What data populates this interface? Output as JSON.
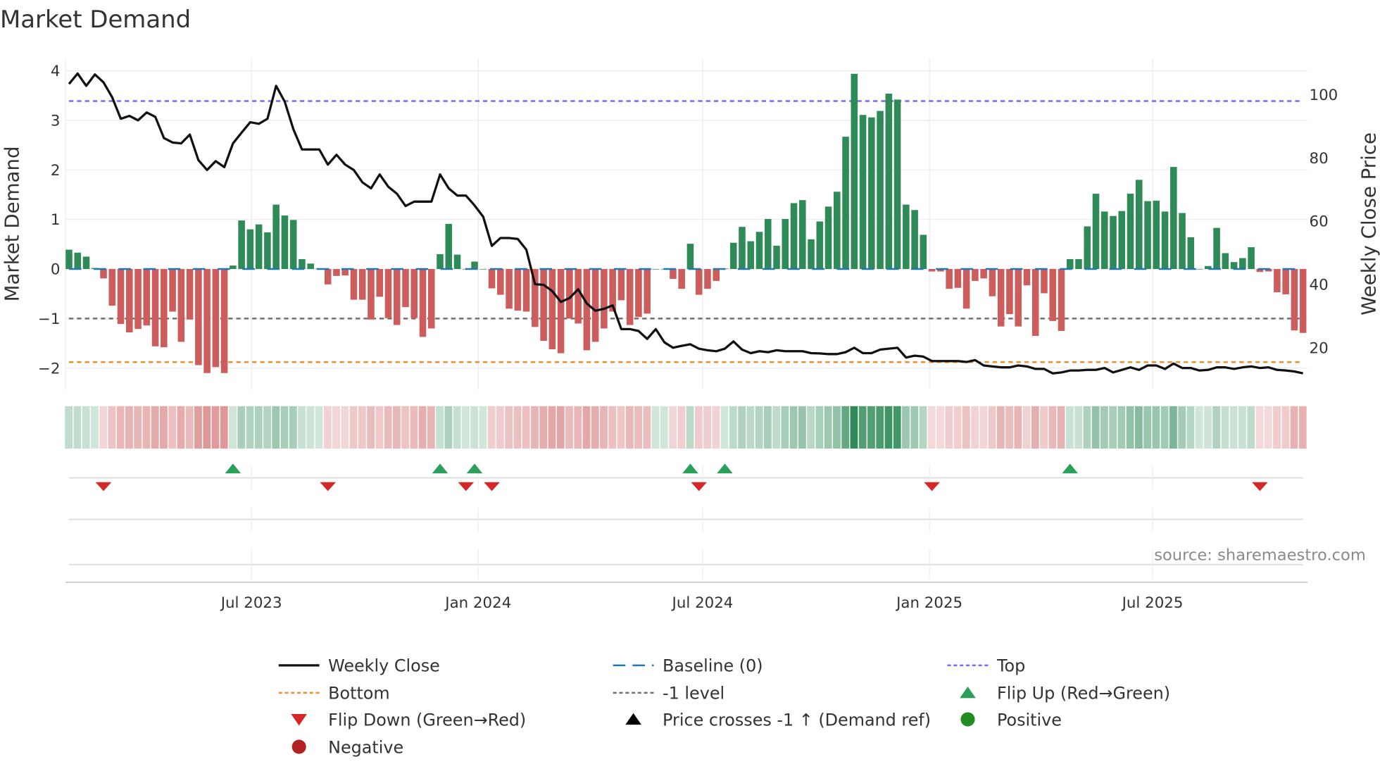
{
  "chart_data": {
    "type": "bar",
    "title": "Market Demand",
    "ylabel": "Market Demand",
    "y2label": "Weekly Close Price",
    "ylim": [
      -2.4,
      4.4
    ],
    "y2lim": [
      10.5,
      108.5
    ],
    "yticks": [
      "4",
      "3",
      "2",
      "1",
      "0",
      "−1",
      "−2"
    ],
    "ytick_values": [
      4,
      3,
      2,
      1,
      0,
      -1,
      -2
    ],
    "y2ticks": [
      "100",
      "80",
      "60",
      "40",
      "20"
    ],
    "y2tick_values": [
      100,
      80,
      60,
      40,
      20
    ],
    "start_date": "2023-02-03",
    "frequency": "weekly",
    "xticks": [
      {
        "label": "Jul 2023",
        "date": "2023-07-01"
      },
      {
        "label": "Jan 2024",
        "date": "2024-01-01"
      },
      {
        "label": "Jul 2024",
        "date": "2024-07-01"
      },
      {
        "label": "Jan 2025",
        "date": "2025-01-01"
      },
      {
        "label": "Jul 2025",
        "date": "2025-07-01"
      }
    ],
    "grid": true,
    "levels": {
      "top": 3.39,
      "bottom": -1.88,
      "minus_one": -1,
      "baseline": 0
    },
    "demand": [
      0.39,
      0.33,
      0.25,
      0.02,
      -0.19,
      -0.74,
      -1.11,
      -1.28,
      -1.21,
      -1.14,
      -1.56,
      -1.58,
      -0.86,
      -1.47,
      -1.02,
      -1.94,
      -2.1,
      -1.98,
      -2.1,
      0.07,
      0.98,
      0.8,
      0.9,
      0.74,
      1.3,
      1.08,
      0.99,
      0.2,
      0.11,
      0.01,
      -0.31,
      -0.14,
      -0.13,
      -0.62,
      -0.62,
      -1.02,
      -0.56,
      -0.99,
      -1.13,
      -0.77,
      -0.99,
      -1.37,
      -1.2,
      0.3,
      0.91,
      0.29,
      0,
      0.15,
      0,
      -0.39,
      -0.52,
      -0.8,
      -0.84,
      -0.86,
      -1.17,
      -1.45,
      -1.62,
      -1.7,
      -1.0,
      -1.1,
      -1.64,
      -1.47,
      -1.2,
      -0.86,
      -0.63,
      -1.13,
      -0.97,
      -0.9,
      0,
      0,
      -0.2,
      -0.4,
      0.51,
      -0.52,
      -0.4,
      -0.24,
      0.01,
      0.53,
      0.85,
      0.56,
      0.75,
      1.01,
      0.47,
      1.01,
      1.33,
      1.39,
      0.6,
      0.96,
      1.26,
      1.56,
      2.67,
      3.94,
      3.11,
      3.06,
      3.19,
      3.54,
      3.42,
      1.3,
      1.19,
      0.69,
      -0.05,
      -0.05,
      -0.4,
      -0.38,
      -0.8,
      -0.24,
      -0.19,
      -0.55,
      -1.16,
      -0.91,
      -1.16,
      -0.33,
      -1.35,
      -0.49,
      -1.05,
      -1.25,
      0.2,
      0.2,
      0.86,
      1.52,
      1.16,
      1.07,
      1.17,
      1.52,
      1.8,
      1.37,
      1.38,
      1.16,
      2.06,
      1.13,
      0.64,
      0,
      0.06,
      0.83,
      0.32,
      0.14,
      0.22,
      0.44,
      -0.06,
      -0.05,
      -0.47,
      -0.51,
      -1.24,
      -1.29
    ],
    "price": [
      103.4,
      106.7,
      102.8,
      106.4,
      103.9,
      99.2,
      92.4,
      93.3,
      91.9,
      94.4,
      93.0,
      86.3,
      84.9,
      84.6,
      87.4,
      79.3,
      76.2,
      79.0,
      77.1,
      84.6,
      88.0,
      91.3,
      90.8,
      92.4,
      102.8,
      97.8,
      89.1,
      82.7,
      82.7,
      82.7,
      77.9,
      81.0,
      77.9,
      76.2,
      72.3,
      70.4,
      74.8,
      70.9,
      68.7,
      64.8,
      66.2,
      66.2,
      66.2,
      74.8,
      70.4,
      68.1,
      68.1,
      65.0,
      61.4,
      52.2,
      54.7,
      54.7,
      54.4,
      51.0,
      40.1,
      39.9,
      37.9,
      34.5,
      35.7,
      38.5,
      34.0,
      31.7,
      32.3,
      33.4,
      25.9,
      25.9,
      25.3,
      22.8,
      25.9,
      21.7,
      20.0,
      20.6,
      21.1,
      19.7,
      19.2,
      18.9,
      19.7,
      22.0,
      19.4,
      18.3,
      18.9,
      18.6,
      19.2,
      18.9,
      18.9,
      18.9,
      18.3,
      18.2,
      18.0,
      18.0,
      18.6,
      20.0,
      18.3,
      18.3,
      19.4,
      19.7,
      20.0,
      16.9,
      17.5,
      17.2,
      15.8,
      15.8,
      15.8,
      15.8,
      15.5,
      16.1,
      14.4,
      14.1,
      13.8,
      13.8,
      14.4,
      14.1,
      13.3,
      13.3,
      11.9,
      12.2,
      12.8,
      12.8,
      13.0,
      13.0,
      13.6,
      12.2,
      13.0,
      13.8,
      13.0,
      14.4,
      14.4,
      13.3,
      15.0,
      13.6,
      13.6,
      12.8,
      13.0,
      13.8,
      13.8,
      13.3,
      13.8,
      14.1,
      13.6,
      13.8,
      13.0,
      12.8,
      12.5,
      11.9
    ],
    "flip_up_weeks": [
      19,
      43,
      47,
      72,
      76,
      116
    ],
    "flip_down_weeks": [
      4,
      30,
      46,
      49,
      73,
      100,
      138
    ],
    "legend": {
      "placement": "bottom",
      "items": [
        {
          "label": "Weekly Close",
          "kind": "line"
        },
        {
          "label": "Baseline (0)",
          "kind": "dash"
        },
        {
          "label": "Top",
          "kind": "dotted-top"
        },
        {
          "label": "Bottom",
          "kind": "dotted-bottom"
        },
        {
          "label": "-1 level",
          "kind": "dotted-gray"
        },
        {
          "label": "Flip Up (Red→Green)",
          "kind": "tri-up"
        },
        {
          "label": "Flip Down (Green→Red)",
          "kind": "tri-down"
        },
        {
          "label": "Price crosses -1 ↑ (Demand ref)",
          "kind": "tri-black"
        },
        {
          "label": "Positive",
          "kind": "dot-green"
        },
        {
          "label": "Negative",
          "kind": "dot-red"
        }
      ]
    },
    "annotation": "source: sharemaestro.com"
  },
  "colors": {
    "positive": "#2e8b57",
    "negative": "#cd5c5c",
    "price": "#111111",
    "baseline": "#1f77b4",
    "top": "#7b68ee",
    "bottom": "#f28e2b",
    "minus_one": "#707070",
    "flip_up": "#2ca05a",
    "flip_down": "#d62728",
    "dot_positive": "#228b22",
    "dot_negative": "#b22222"
  }
}
